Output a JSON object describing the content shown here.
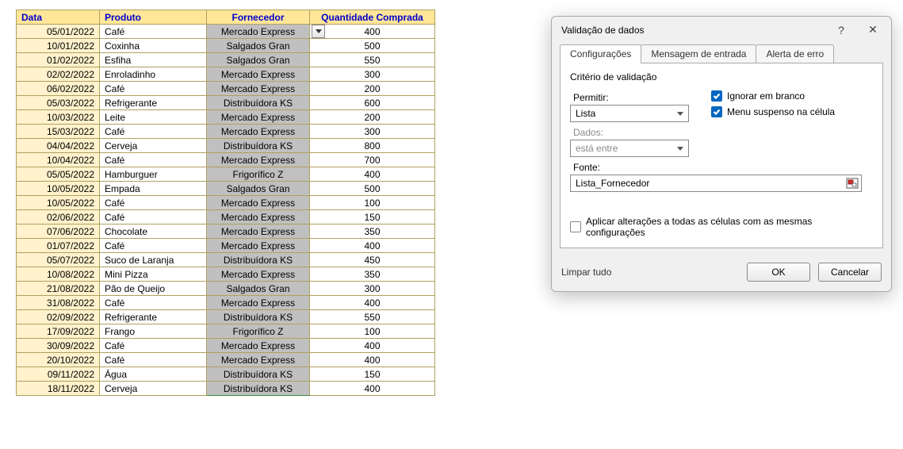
{
  "table": {
    "headers": {
      "data": "Data",
      "produto": "Produto",
      "fornecedor": "Fornecedor",
      "quantidade": "Quantidade Comprada"
    },
    "rows": [
      {
        "data": "05/01/2022",
        "produto": "Café",
        "fornecedor": "Mercado Express",
        "quantidade": "400"
      },
      {
        "data": "10/01/2022",
        "produto": "Coxinha",
        "fornecedor": "Salgados Gran",
        "quantidade": "500"
      },
      {
        "data": "01/02/2022",
        "produto": "Esfiha",
        "fornecedor": "Salgados Gran",
        "quantidade": "550"
      },
      {
        "data": "02/02/2022",
        "produto": "Enroladinho",
        "fornecedor": "Mercado Express",
        "quantidade": "300"
      },
      {
        "data": "06/02/2022",
        "produto": "Café",
        "fornecedor": "Mercado Express",
        "quantidade": "200"
      },
      {
        "data": "05/03/2022",
        "produto": "Refrigerante",
        "fornecedor": "Distribuídora KS",
        "quantidade": "600"
      },
      {
        "data": "10/03/2022",
        "produto": "Leite",
        "fornecedor": "Mercado Express",
        "quantidade": "200"
      },
      {
        "data": "15/03/2022",
        "produto": "Café",
        "fornecedor": "Mercado Express",
        "quantidade": "300"
      },
      {
        "data": "04/04/2022",
        "produto": "Cerveja",
        "fornecedor": "Distribuídora KS",
        "quantidade": "800"
      },
      {
        "data": "10/04/2022",
        "produto": "Café",
        "fornecedor": "Mercado Express",
        "quantidade": "700"
      },
      {
        "data": "05/05/2022",
        "produto": "Hamburguer",
        "fornecedor": "Frigorífico Z",
        "quantidade": "400"
      },
      {
        "data": "10/05/2022",
        "produto": "Empada",
        "fornecedor": "Salgados Gran",
        "quantidade": "500"
      },
      {
        "data": "10/05/2022",
        "produto": "Café",
        "fornecedor": "Mercado Express",
        "quantidade": "100"
      },
      {
        "data": "02/06/2022",
        "produto": "Café",
        "fornecedor": "Mercado Express",
        "quantidade": "150"
      },
      {
        "data": "07/06/2022",
        "produto": "Chocolate",
        "fornecedor": "Mercado Express",
        "quantidade": "350"
      },
      {
        "data": "01/07/2022",
        "produto": "Café",
        "fornecedor": "Mercado Express",
        "quantidade": "400"
      },
      {
        "data": "05/07/2022",
        "produto": "Suco de Laranja",
        "fornecedor": "Distribuídora KS",
        "quantidade": "450"
      },
      {
        "data": "10/08/2022",
        "produto": "Mini Pizza",
        "fornecedor": "Mercado Express",
        "quantidade": "350"
      },
      {
        "data": "21/08/2022",
        "produto": "Pão de Queijo",
        "fornecedor": "Salgados Gran",
        "quantidade": "300"
      },
      {
        "data": "31/08/2022",
        "produto": "Café",
        "fornecedor": "Mercado Express",
        "quantidade": "400"
      },
      {
        "data": "02/09/2022",
        "produto": "Refrigerante",
        "fornecedor": "Distribuídora KS",
        "quantidade": "550"
      },
      {
        "data": "17/09/2022",
        "produto": "Frango",
        "fornecedor": "Frigorífico Z",
        "quantidade": "100"
      },
      {
        "data": "30/09/2022",
        "produto": "Café",
        "fornecedor": "Mercado Express",
        "quantidade": "400"
      },
      {
        "data": "20/10/2022",
        "produto": "Café",
        "fornecedor": "Mercado Express",
        "quantidade": "400"
      },
      {
        "data": "09/11/2022",
        "produto": "Água",
        "fornecedor": "Distribuídora KS",
        "quantidade": "150"
      },
      {
        "data": "18/11/2022",
        "produto": "Cerveja",
        "fornecedor": "Distribuídora KS",
        "quantidade": "400"
      }
    ]
  },
  "dialog": {
    "title": "Validação de dados",
    "help": "?",
    "close": "✕",
    "tabs": {
      "t1": "Configurações",
      "t2": "Mensagem de entrada",
      "t3": "Alerta de erro"
    },
    "group": "Critério de validação",
    "permitir_label": "Permitir:",
    "permitir_value": "Lista",
    "dados_label": "Dados:",
    "dados_value": "está entre",
    "chk_ignorar": "Ignorar em branco",
    "chk_menu": "Menu suspenso na célula",
    "fonte_label": "Fonte:",
    "fonte_value": "Lista_Fornecedor",
    "chk_aplicar": "Aplicar alterações a todas as células com as mesmas configurações",
    "limpar": "Limpar tudo",
    "ok": "OK",
    "cancelar": "Cancelar"
  }
}
